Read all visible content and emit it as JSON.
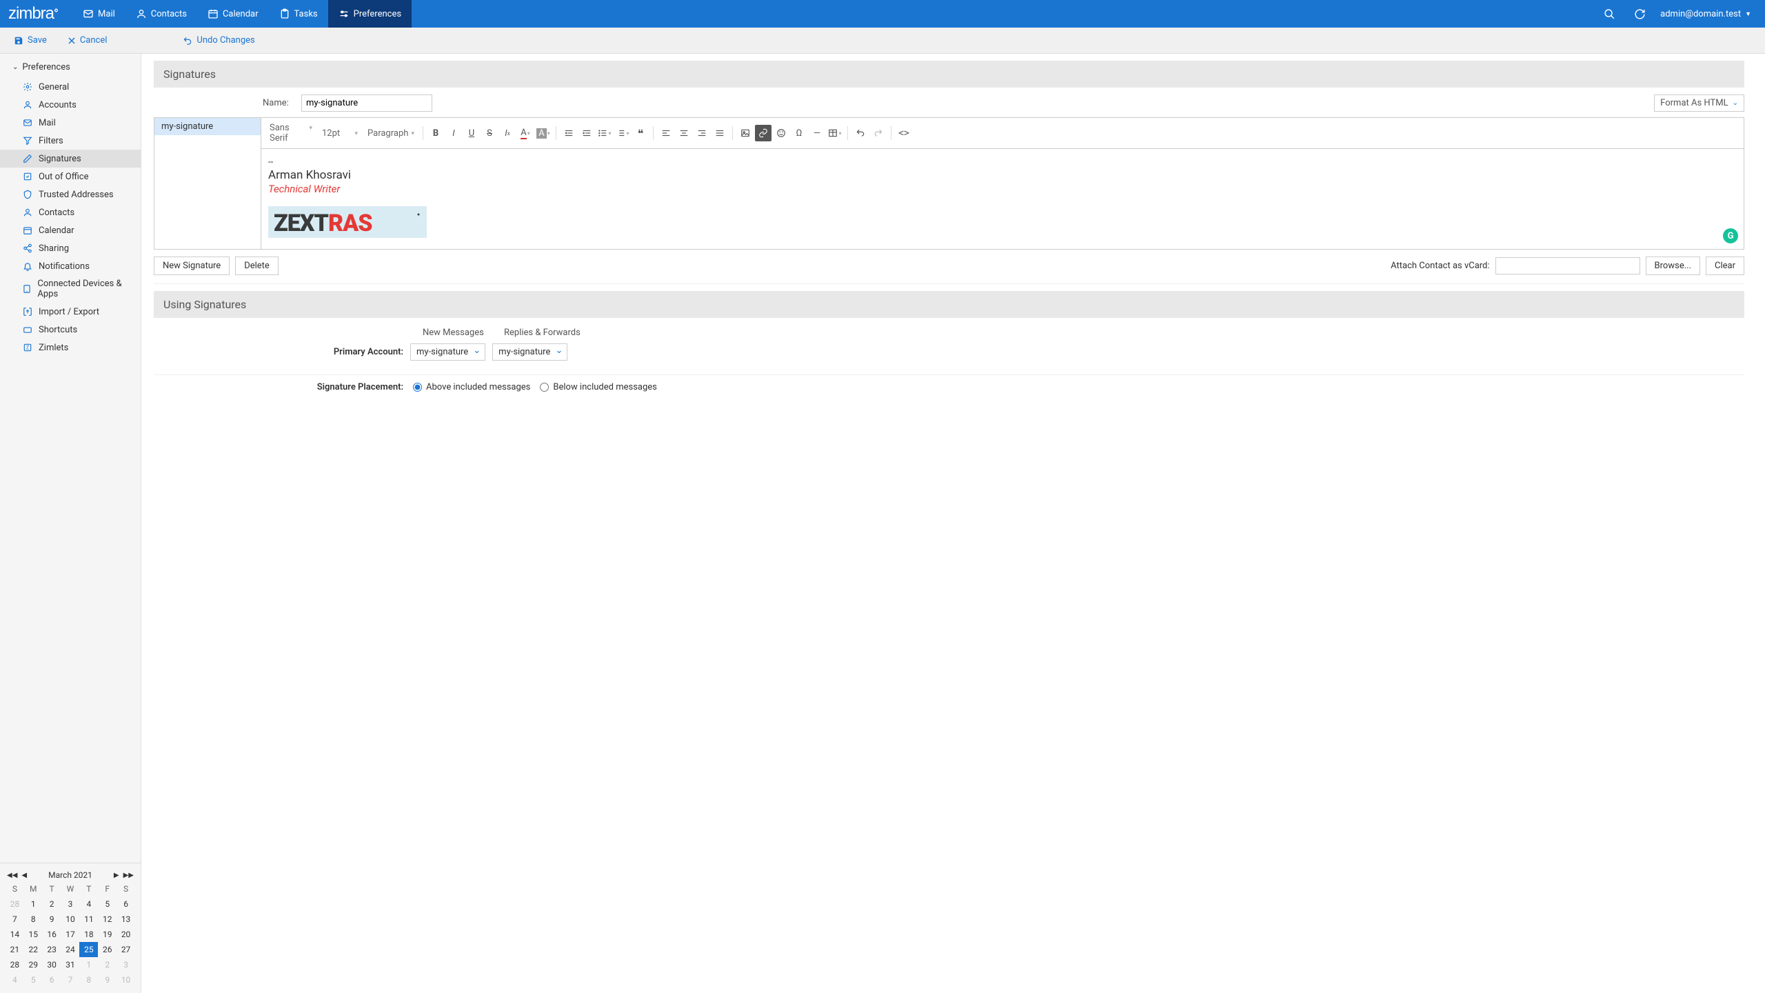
{
  "topnav": {
    "logo": "zimbra",
    "tabs": [
      {
        "label": "Mail"
      },
      {
        "label": "Contacts"
      },
      {
        "label": "Calendar"
      },
      {
        "label": "Tasks"
      },
      {
        "label": "Preferences"
      }
    ],
    "user": "admin@domain.test"
  },
  "actionbar": {
    "save": "Save",
    "cancel": "Cancel",
    "undo": "Undo Changes"
  },
  "sidebar": {
    "root": "Preferences",
    "items": [
      "General",
      "Accounts",
      "Mail",
      "Filters",
      "Signatures",
      "Out of Office",
      "Trusted Addresses",
      "Contacts",
      "Calendar",
      "Sharing",
      "Notifications",
      "Connected Devices & Apps",
      "Import / Export",
      "Shortcuts",
      "Zimlets"
    ],
    "active": "Signatures"
  },
  "minical": {
    "title": "March 2021",
    "dow": [
      "S",
      "M",
      "T",
      "W",
      "T",
      "F",
      "S"
    ],
    "days": [
      {
        "n": "28",
        "o": true
      },
      {
        "n": "1"
      },
      {
        "n": "2"
      },
      {
        "n": "3"
      },
      {
        "n": "4"
      },
      {
        "n": "5"
      },
      {
        "n": "6"
      },
      {
        "n": "7"
      },
      {
        "n": "8"
      },
      {
        "n": "9"
      },
      {
        "n": "10"
      },
      {
        "n": "11"
      },
      {
        "n": "12"
      },
      {
        "n": "13"
      },
      {
        "n": "14"
      },
      {
        "n": "15"
      },
      {
        "n": "16"
      },
      {
        "n": "17"
      },
      {
        "n": "18"
      },
      {
        "n": "19"
      },
      {
        "n": "20"
      },
      {
        "n": "21"
      },
      {
        "n": "22"
      },
      {
        "n": "23"
      },
      {
        "n": "24"
      },
      {
        "n": "25",
        "t": true
      },
      {
        "n": "26"
      },
      {
        "n": "27"
      },
      {
        "n": "28"
      },
      {
        "n": "29"
      },
      {
        "n": "30"
      },
      {
        "n": "31"
      },
      {
        "n": "1",
        "o": true
      },
      {
        "n": "2",
        "o": true
      },
      {
        "n": "3",
        "o": true
      },
      {
        "n": "4",
        "o": true
      },
      {
        "n": "5",
        "o": true
      },
      {
        "n": "6",
        "o": true
      },
      {
        "n": "7",
        "o": true
      },
      {
        "n": "8",
        "o": true
      },
      {
        "n": "9",
        "o": true
      },
      {
        "n": "10",
        "o": true
      }
    ]
  },
  "sections": {
    "signatures": "Signatures",
    "using": "Using Signatures"
  },
  "editor": {
    "name_label": "Name:",
    "name_value": "my-signature",
    "format": "Format As HTML",
    "siglist": [
      "my-signature"
    ],
    "font": "Sans Serif",
    "size": "12pt",
    "block": "Paragraph",
    "content": {
      "sep": "--",
      "name": "Arman Khosravi",
      "title": "Technical Writer",
      "logo_text": "ZEXTRAS"
    },
    "new_btn": "New Signature",
    "delete_btn": "Delete",
    "vcard_label": "Attach Contact as vCard:",
    "browse_btn": "Browse...",
    "clear_btn": "Clear"
  },
  "using": {
    "col_new": "New Messages",
    "col_reply": "Replies & Forwards",
    "account_label": "Primary Account:",
    "sel_new": "my-signature",
    "sel_reply": "my-signature",
    "placement_label": "Signature Placement:",
    "opt_above": "Above included messages",
    "opt_below": "Below included messages"
  }
}
